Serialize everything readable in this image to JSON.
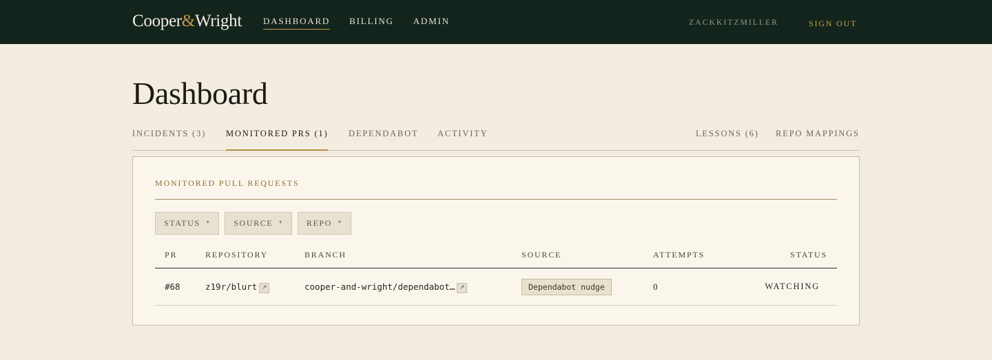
{
  "brand": {
    "name_left": "Cooper",
    "amp": "&",
    "name_right": "Wright"
  },
  "nav": {
    "dashboard": "DASHBOARD",
    "billing": "BILLING",
    "admin": "ADMIN"
  },
  "user": {
    "name": "ZACKKITZMILLER",
    "sign_out": "SIGN OUT"
  },
  "page": {
    "title": "Dashboard"
  },
  "tabs": {
    "incidents": "INCIDENTS (3)",
    "monitored_prs": "MONITORED PRS (1)",
    "dependabot": "DEPENDABOT",
    "activity": "ACTIVITY",
    "lessons": "LESSONS (6)",
    "repo_mappings": "REPO MAPPINGS"
  },
  "panel": {
    "title": "MONITORED PULL REQUESTS"
  },
  "filters": {
    "status": "STATUS",
    "source": "SOURCE",
    "repo": "REPO",
    "caret": "▾"
  },
  "table": {
    "headers": {
      "pr": "PR",
      "repository": "REPOSITORY",
      "branch": "BRANCH",
      "source": "SOURCE",
      "attempts": "ATTEMPTS",
      "status": "STATUS"
    },
    "rows": [
      {
        "pr": "#68",
        "repository": "z19r/blurt",
        "branch": "cooper-and-wright/dependabot…",
        "source": "Dependabot nudge",
        "attempts": "0",
        "status": "WATCHING"
      }
    ]
  },
  "icons": {
    "external_link": "external-link-icon",
    "caret": "chevron-down-icon"
  },
  "colors": {
    "topbar": "#13241c",
    "accent": "#c49a4a",
    "background": "#f3ede1",
    "panel": "#fbf6ec"
  }
}
